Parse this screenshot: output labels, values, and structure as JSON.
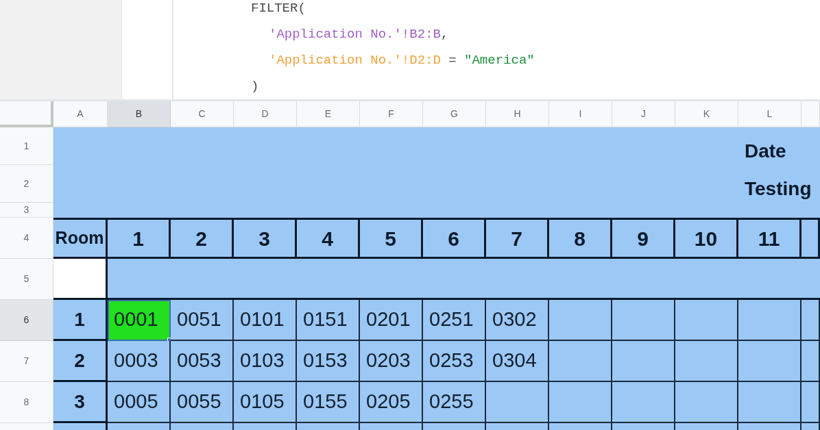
{
  "formula": {
    "function": "FILTER(",
    "arguments": [
      {
        "segments": [
          {
            "text": "'Application No.'!B2:B",
            "color": "#a05fc9"
          },
          {
            "text": ",",
            "color": "#4a4a4a"
          }
        ]
      },
      {
        "segments": [
          {
            "text": "'Application No.'!D2:D",
            "color": "#eea33c"
          },
          {
            "text": " = ",
            "color": "#4a4a4a"
          },
          {
            "text": "\"America\"",
            "color": "#1e8e3e"
          }
        ]
      }
    ],
    "close": ")"
  },
  "sheet": {
    "columns": [
      {
        "label": "A",
        "selected": false
      },
      {
        "label": "B",
        "selected": true
      },
      {
        "label": "C",
        "selected": false
      },
      {
        "label": "D",
        "selected": false
      },
      {
        "label": "E",
        "selected": false
      },
      {
        "label": "F",
        "selected": false
      },
      {
        "label": "G",
        "selected": false
      },
      {
        "label": "H",
        "selected": false
      },
      {
        "label": "I",
        "selected": false
      },
      {
        "label": "J",
        "selected": false
      },
      {
        "label": "K",
        "selected": false
      },
      {
        "label": "L",
        "selected": false
      },
      {
        "selected": false
      }
    ],
    "rows": [
      {
        "label": "1",
        "selected": false
      },
      {
        "label": "2",
        "selected": false
      },
      {
        "label": "3",
        "selected": false
      },
      {
        "label": "4",
        "selected": false
      },
      {
        "label": "5",
        "selected": false
      },
      {
        "label": "6",
        "selected": true
      },
      {
        "label": "7",
        "selected": false
      },
      {
        "label": "8",
        "selected": false
      }
    ],
    "title_block": {
      "lines": [
        "Date",
        "Testing"
      ]
    },
    "header_row": {
      "label": "Room",
      "numbers": [
        "1",
        "2",
        "3",
        "4",
        "5",
        "6",
        "7",
        "8",
        "9",
        "10",
        "11"
      ]
    },
    "room_rows": [
      {
        "room": "1",
        "cells": [
          {
            "value": "0001",
            "selected": true,
            "color": "#22e01e"
          },
          {
            "value": "0051",
            "selected": false
          },
          {
            "value": "0101",
            "selected": false
          },
          {
            "value": "0151",
            "selected": false
          },
          {
            "value": "0201",
            "selected": false
          },
          {
            "value": "0251",
            "selected": false
          },
          {
            "value": "0302",
            "selected": false
          }
        ]
      },
      {
        "room": "2",
        "cells": [
          {
            "value": "0003",
            "selected": false
          },
          {
            "value": "0053",
            "selected": false
          },
          {
            "value": "0103",
            "selected": false
          },
          {
            "value": "0153",
            "selected": false
          },
          {
            "value": "0203",
            "selected": false
          },
          {
            "value": "0253",
            "selected": false
          },
          {
            "value": "0304",
            "selected": false
          }
        ]
      },
      {
        "room": "3",
        "cells": [
          {
            "value": "0005",
            "selected": false
          },
          {
            "value": "0055",
            "selected": false
          },
          {
            "value": "0105",
            "selected": false
          },
          {
            "value": "0155",
            "selected": false
          },
          {
            "value": "0205",
            "selected": false
          },
          {
            "value": "0255",
            "selected": false
          }
        ]
      }
    ]
  }
}
